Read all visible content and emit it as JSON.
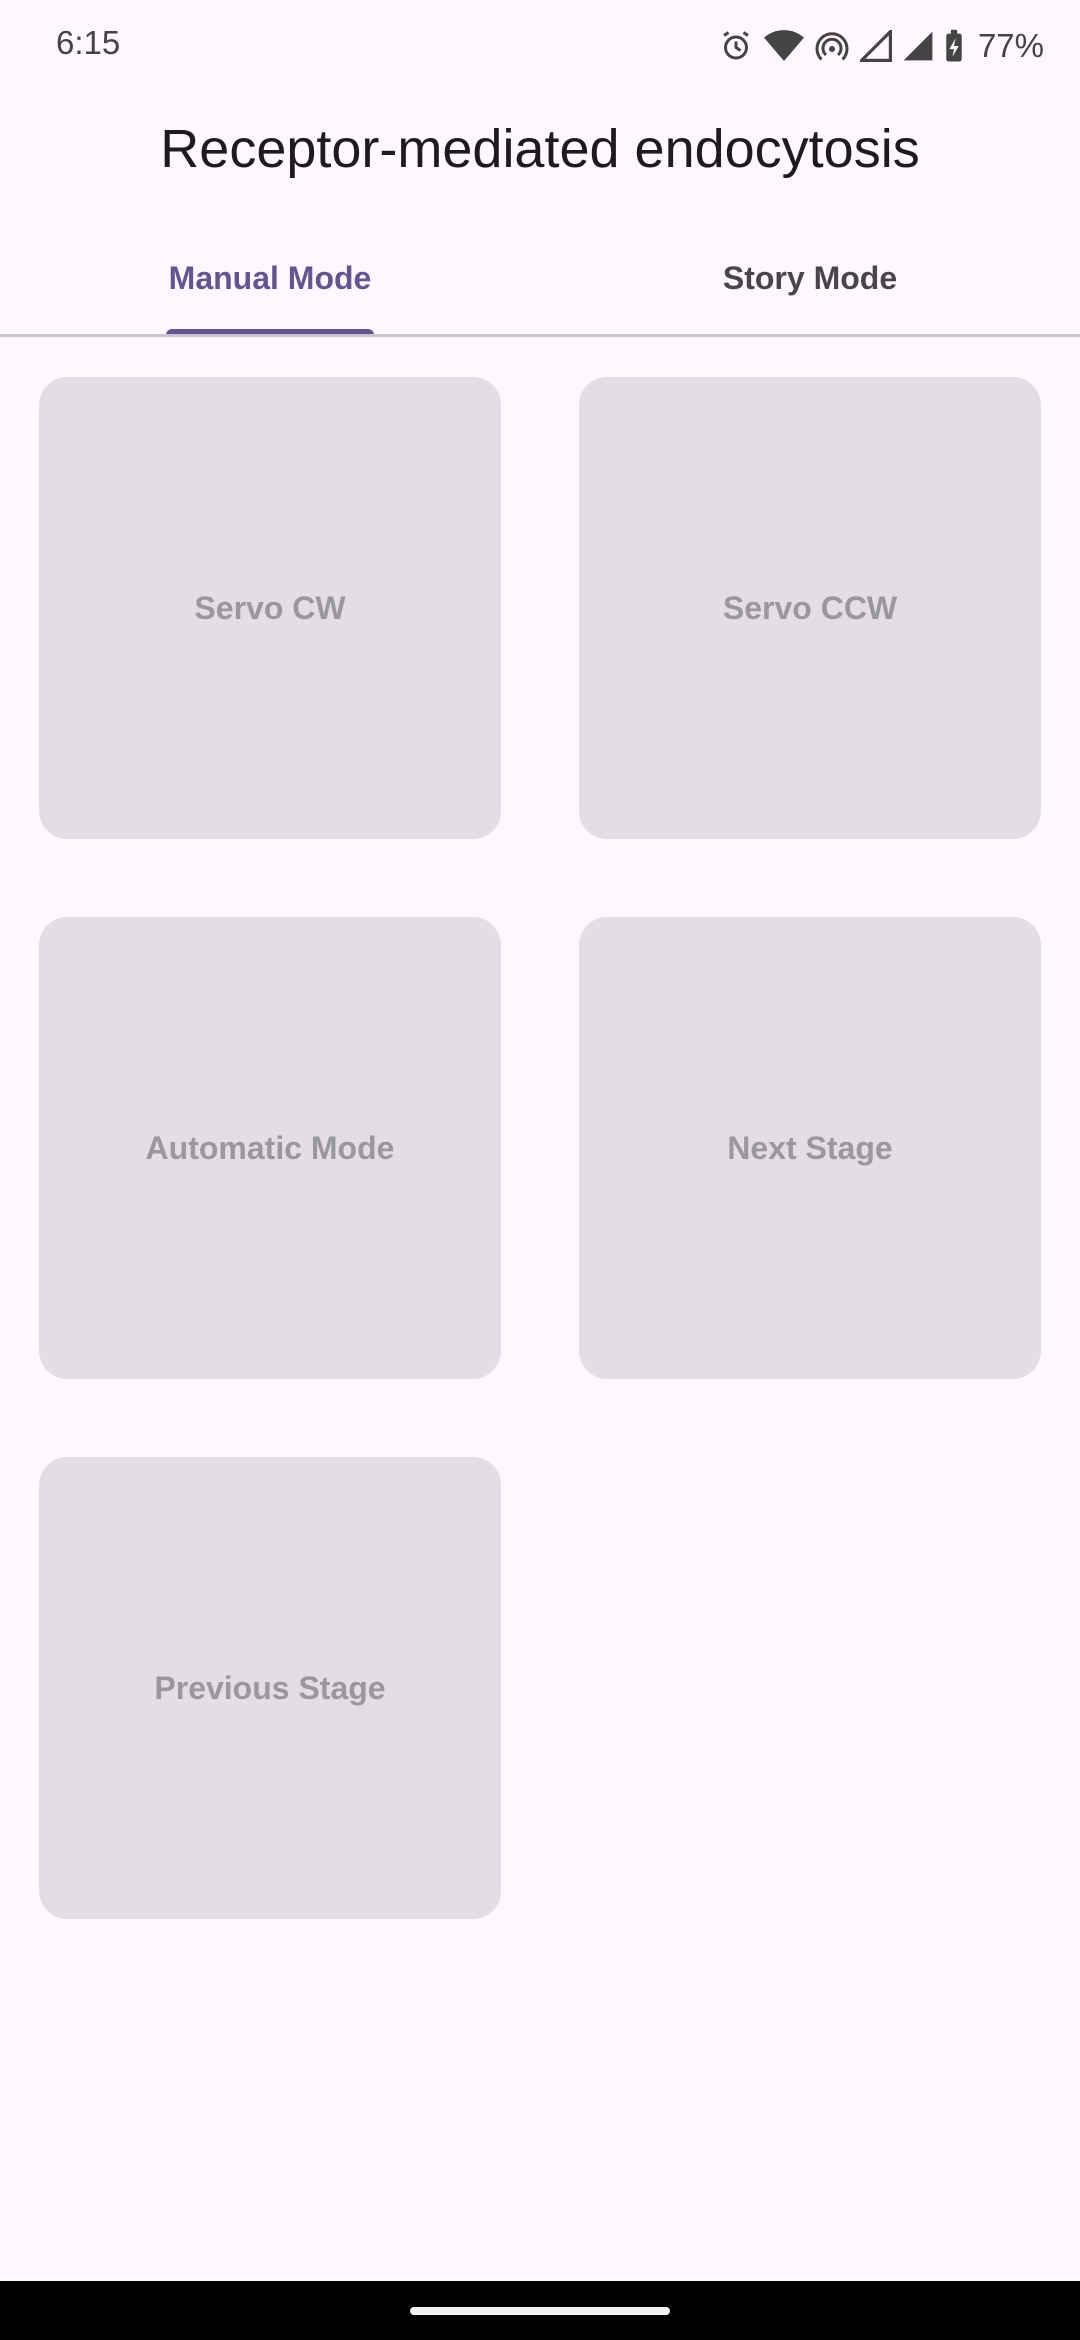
{
  "status_bar": {
    "time": "6:15",
    "battery_percent": "77%",
    "icons": [
      "alarm-icon",
      "wifi-icon",
      "hotspot-icon",
      "signal-icon",
      "signal-icon",
      "battery-charging-icon"
    ]
  },
  "app_bar": {
    "title": "Receptor-mediated endocytosis"
  },
  "tabs": [
    {
      "label": "Manual Mode",
      "selected": true
    },
    {
      "label": "Story Mode",
      "selected": false
    }
  ],
  "buttons": [
    {
      "label": "Servo CW"
    },
    {
      "label": "Servo CCW"
    },
    {
      "label": "Automatic Mode"
    },
    {
      "label": "Next Stage"
    },
    {
      "label": "Previous Stage"
    }
  ],
  "colors": {
    "background": "#fef7ff",
    "accent": "#65558f",
    "button_bg": "#e2dee4",
    "button_text": "#9a979d"
  }
}
